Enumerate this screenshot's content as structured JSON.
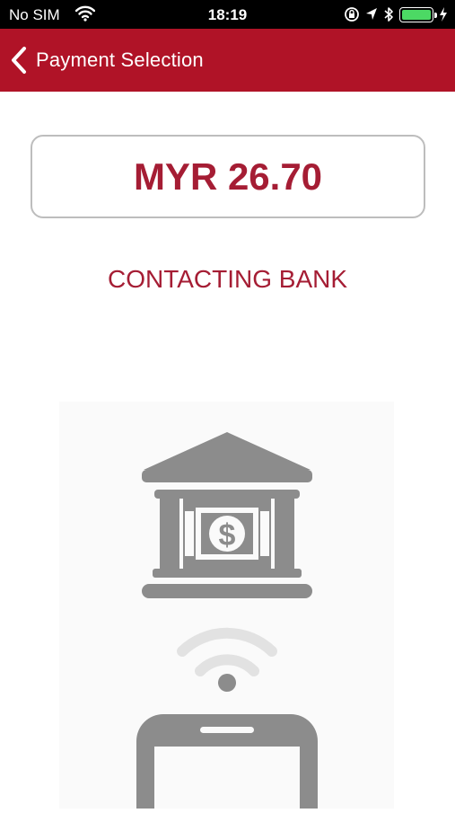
{
  "status_bar": {
    "carrier": "No SIM",
    "time": "18:19",
    "battery_color": "#4cd964"
  },
  "nav": {
    "back_icon": "chevron-left-icon",
    "title": "Payment Selection",
    "color": "#b01327"
  },
  "amount": {
    "text": "MYR 26.70",
    "color": "#a51d34"
  },
  "status_message": "CONTACTING BANK",
  "illustration": {
    "icons": [
      "bank-icon",
      "dollar-icon",
      "wireless-signal-icon",
      "phone-icon"
    ],
    "icon_color": "#8c8c8c"
  }
}
